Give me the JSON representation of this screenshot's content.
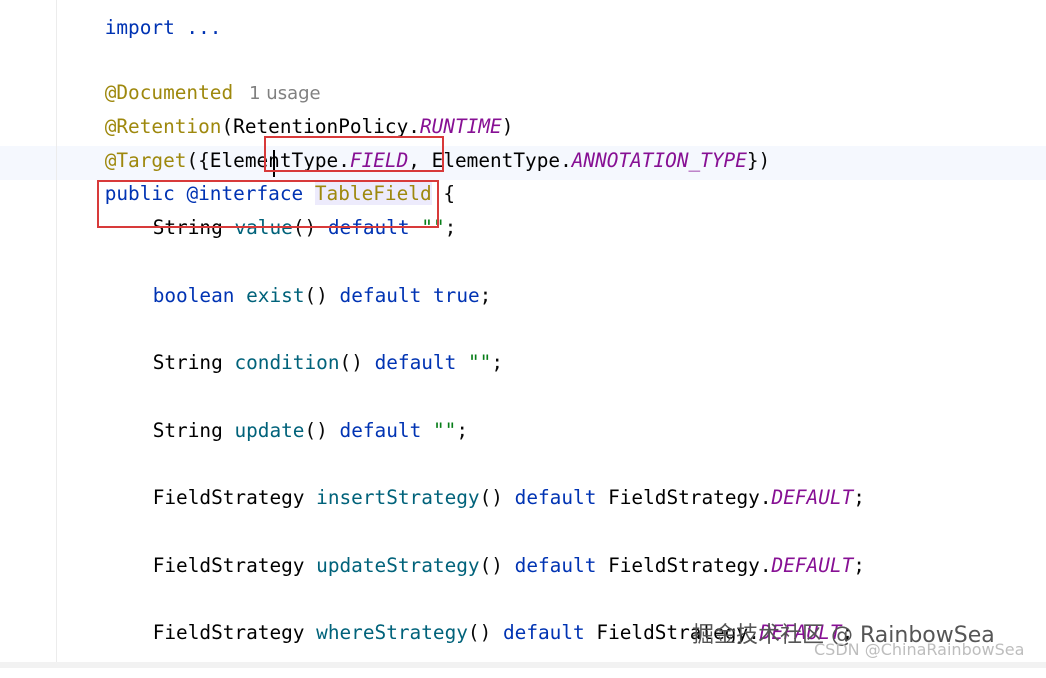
{
  "editor": {
    "top_fragment": "import ...",
    "lines": {
      "documented": {
        "annotation": "@Documented",
        "usage_hint": "1 usage"
      },
      "retention": {
        "annotation": "@Retention",
        "open": "(",
        "policy_class": "RetentionPolicy",
        "dot": ".",
        "policy_value": "RUNTIME",
        "close": ")"
      },
      "target": {
        "annotation": "@Target",
        "open": "({",
        "type1_class": "ElementType",
        "dot1": ".",
        "type1_value": "FIELD",
        "comma": ", ",
        "type2_class": "ElementType",
        "dot2": ".",
        "type2_value": "ANNOTATION_TYPE",
        "close": "})"
      },
      "declaration": {
        "modifier": "public",
        "keyword": "@interface",
        "name": "TableField",
        "brace": "{"
      },
      "value": {
        "type": "String",
        "method": "value",
        "parens": "()",
        "default_kw": "default",
        "default_val": "\"\"",
        "semi": ";"
      },
      "exist": {
        "type": "boolean",
        "method": "exist",
        "parens": "()",
        "default_kw": "default",
        "default_val": "true",
        "semi": ";"
      },
      "condition": {
        "type": "String",
        "method": "condition",
        "parens": "()",
        "default_kw": "default",
        "default_val": "\"\"",
        "semi": ";"
      },
      "update": {
        "type": "String",
        "method": "update",
        "parens": "()",
        "default_kw": "default",
        "default_val": "\"\"",
        "semi": ";"
      },
      "insert_strategy": {
        "type": "FieldStrategy",
        "method": "insertStrategy",
        "parens": "()",
        "default_kw": "default",
        "enum_class": "FieldStrategy",
        "dot": ".",
        "enum_value": "DEFAULT",
        "semi": ";"
      },
      "update_strategy": {
        "type": "FieldStrategy",
        "method": "updateStrategy",
        "parens": "()",
        "default_kw": "default",
        "enum_class": "FieldStrategy",
        "dot": ".",
        "enum_value": "DEFAULT",
        "semi": ";"
      },
      "where_strategy": {
        "type": "FieldStrategy",
        "method": "whereStrategy",
        "parens": "()",
        "default_kw": "default",
        "enum_class": "FieldStrategy",
        "dot": ".",
        "enum_value": "DEFAULT",
        "semi": ";"
      }
    }
  },
  "colors": {
    "keyword": "#0033b3",
    "annotation": "#9e880d",
    "method": "#00627a",
    "string": "#067d17",
    "constant": "#871094",
    "highlight_box": "#d83a3a"
  },
  "watermark": {
    "main": "掘金技术社区 @ RainbowSea",
    "sub": "CSDN @ChinaRainbowSea"
  }
}
